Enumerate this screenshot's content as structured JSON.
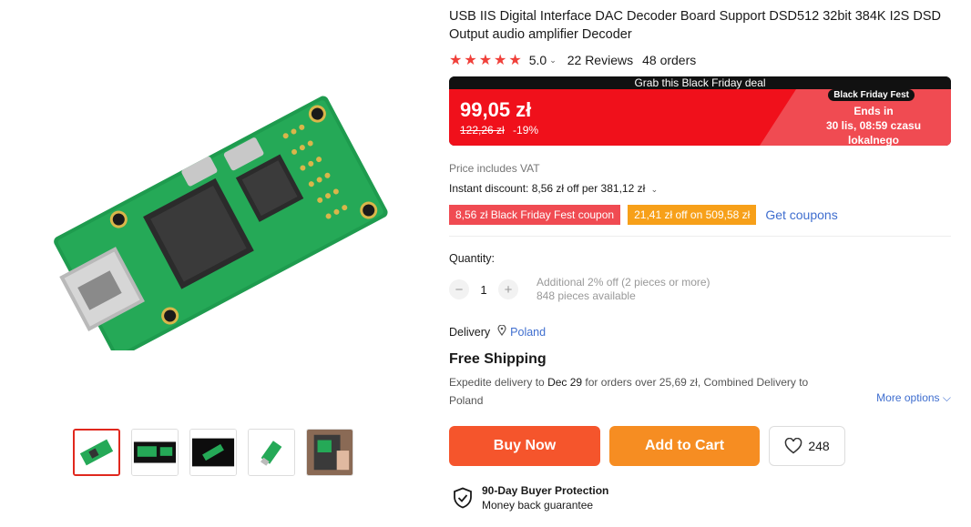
{
  "product": {
    "title": "USB IIS Digital Interface DAC Decoder Board Support DSD512 32bit 384K I2S DSD Output audio amplifier Decoder",
    "rating": "5.0",
    "reviews": "22 Reviews",
    "orders": "48 orders"
  },
  "deal": {
    "banner": "Grab this Black Friday deal",
    "price": "99,05 zł",
    "original_price": "122,26 zł",
    "discount": "-19%",
    "badge": "Black Friday Fest",
    "ends_line1": "Ends in",
    "ends_line2": "30 lis, 08:59 czasu lokalnego"
  },
  "pricing": {
    "vat_note": "Price includes VAT",
    "instant_discount": "Instant discount: 8,56 zł off per 381,12 zł"
  },
  "coupons": {
    "coupon1": "8,56 zł Black Friday Fest coupon",
    "coupon2": "21,41 zł off on 509,58 zł",
    "get_coupons": "Get coupons"
  },
  "quantity": {
    "label": "Quantity:",
    "value": "1",
    "minus": "−",
    "plus": "+",
    "additional": "Additional 2% off (2 pieces or more)",
    "available": "848 pieces available"
  },
  "delivery": {
    "label": "Delivery",
    "country": "Poland",
    "free_shipping": "Free Shipping",
    "desc_prefix": "Expedite delivery to ",
    "desc_date": "Dec 29",
    "desc_suffix": " for orders over 25,69 zł, Combined Delivery to Poland",
    "more_options": "More options"
  },
  "actions": {
    "buy_now": "Buy Now",
    "add_to_cart": "Add to Cart",
    "wishlist_count": "248"
  },
  "protection": {
    "title": "90-Day Buyer Protection",
    "subtitle": "Money back guarantee"
  },
  "icons": {
    "star": "star-icon",
    "heart": "heart-icon",
    "shield": "shield-check-icon",
    "pin": "location-pin-icon"
  },
  "colors": {
    "deal_red": "#f0101b",
    "buy_now": "#f5552c",
    "add_to_cart": "#f68d22",
    "link_blue": "#3f6ecf",
    "star": "#f0403a"
  }
}
